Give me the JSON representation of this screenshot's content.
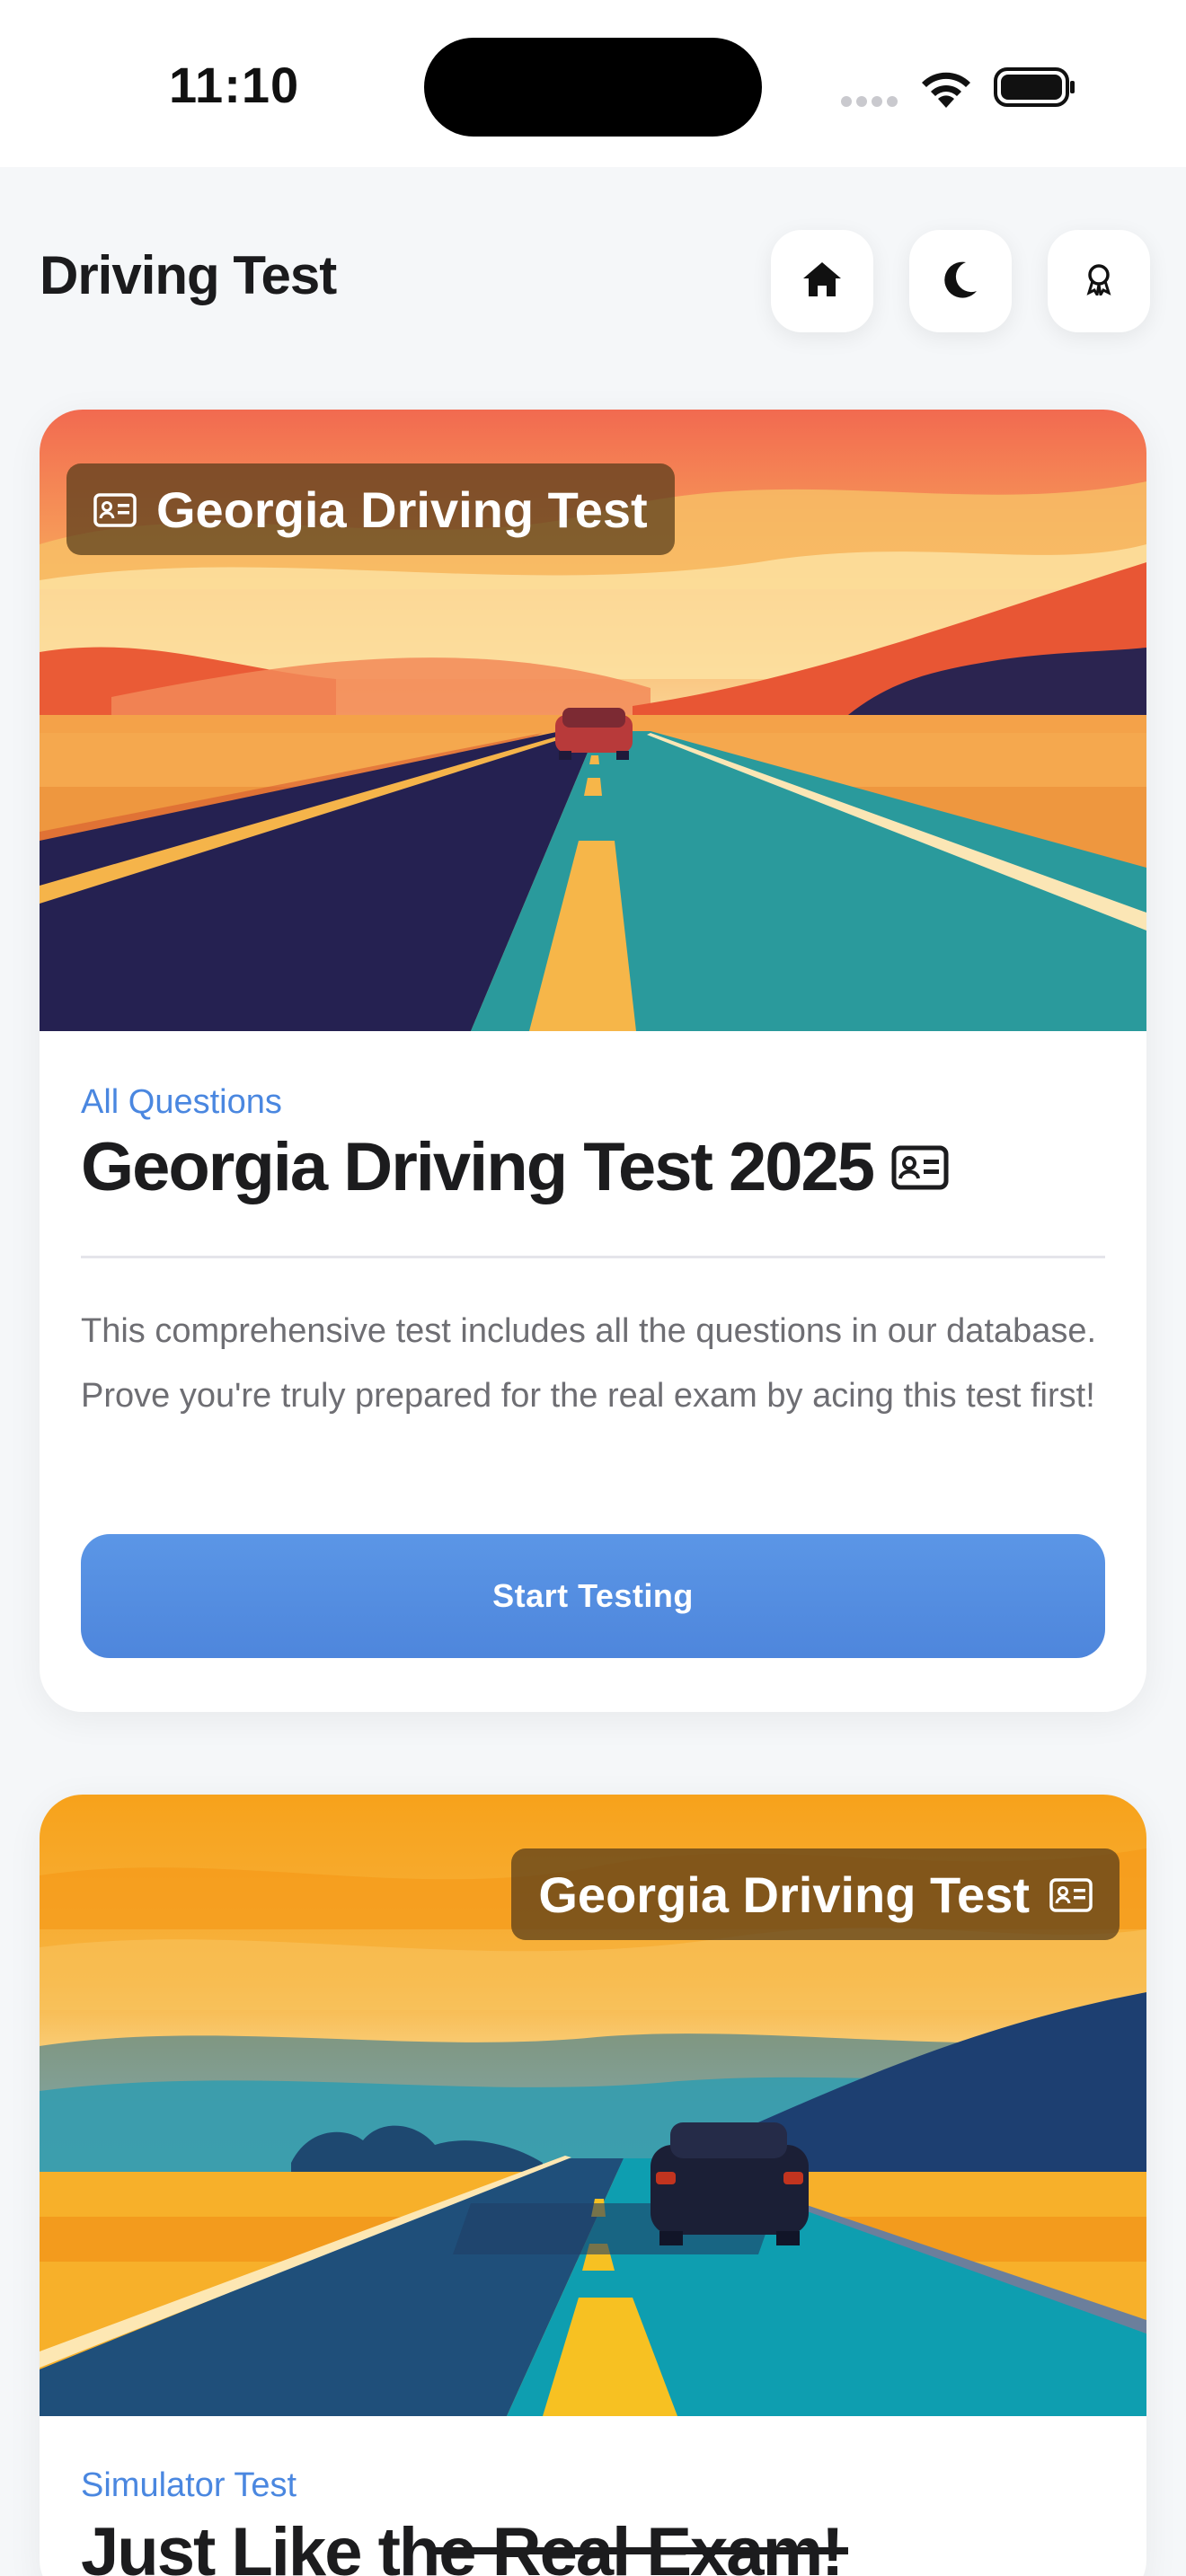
{
  "status_bar": {
    "time": "11:10"
  },
  "header": {
    "title": "Driving Test",
    "buttons": [
      {
        "icon": "home-icon"
      },
      {
        "icon": "moon-icon"
      },
      {
        "icon": "award-icon"
      }
    ]
  },
  "cards": [
    {
      "badge": "Georgia Driving Test",
      "category": "All Questions",
      "title": "Georgia Driving Test 2025",
      "title_icon": "id-card-icon",
      "description": "This comprehensive test includes all the questions in our database. Prove you're truly prepared for the real exam by acing this test first!",
      "button_label": "Start Testing"
    },
    {
      "badge": "Georgia Driving Test",
      "category": "Simulator Test",
      "title": "Just Like the Real Exam!"
    }
  ],
  "colors": {
    "accent": "#4a87e0",
    "button": "#5590e2",
    "background": "#f5f7f9",
    "badge": "#553a19"
  }
}
